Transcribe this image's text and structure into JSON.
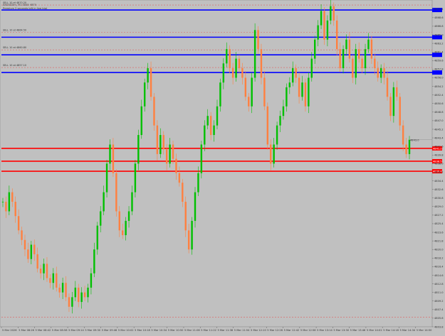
{
  "window": {
    "symbol_line": "XAUUSDm, M1  4845 4870",
    "info_line": "Premium 2 seconds left in live trial"
  },
  "colors": {
    "background": "#c0c0c0",
    "bull_candle": "#00c000",
    "bear_candle": "#ff8040",
    "resistance": "#0000ff",
    "support": "#ff0000",
    "dashed_level": "#e06060",
    "axis_text": "#333333"
  },
  "resistance_levels": [
    {
      "label": "SELL 10 at 4870.20",
      "price": 4870.2
    },
    {
      "label": "SELL 10 at 4864.50",
      "price": 4864.5
    },
    {
      "label": "SELL 10 at 4860.80",
      "price": 4860.8
    },
    {
      "label": "SELL 10 at 4857.10",
      "price": 4857.1
    }
  ],
  "support_levels": [
    {
      "tag": "4841.2",
      "price": 4841.2
    },
    {
      "tag": "4838.5",
      "price": 4838.5
    },
    {
      "tag": "4836.4",
      "price": 4836.4
    }
  ],
  "price_axis": {
    "labels": [
      "4870.4",
      "4868.6",
      "4866.8",
      "4865.0",
      "4863.2",
      "4861.4",
      "4859.6",
      "4857.8",
      "4856.0",
      "4854.2",
      "4852.4",
      "4850.6",
      "4848.8",
      "4847.0",
      "4845.2",
      "4843.4",
      "4841.6",
      "4839.8",
      "4838.0",
      "4836.2",
      "4834.4",
      "4832.6",
      "4830.8",
      "4829.0",
      "4827.2",
      "4825.4",
      "4823.6",
      "4821.8",
      "4820.0",
      "4818.2",
      "4816.4",
      "4814.6",
      "4812.8",
      "4811.0",
      "4809.2",
      "4807.4",
      "4805.6",
      "4803.8"
    ],
    "min": 4803.8,
    "max": 4872.0
  },
  "current_price": {
    "value": 4843.0,
    "tag": "4843.0"
  },
  "time_axis": {
    "labels": [
      "5 Mar 2026",
      "5 Mar 08:26",
      "5 Mar 08:42",
      "5 Mar 08:58",
      "5 Mar 09:14",
      "5 Mar 09:30",
      "5 Mar 09:46",
      "5 Mar 10:02",
      "5 Mar 10:18",
      "5 Mar 10:34",
      "5 Mar 10:50",
      "5 Mar 11:06",
      "5 Mar 11:22",
      "5 Mar 11:38",
      "5 Mar 11:54",
      "5 Mar 12:10",
      "5 Mar 12:26",
      "5 Mar 12:42",
      "5 Mar 12:58",
      "5 Mar 13:14",
      "5 Mar 13:30",
      "5 Mar 13:46",
      "5 Mar 14:02",
      "5 Mar 14:18",
      "5 Mar 14:34",
      "5 Mar 14:50"
    ]
  },
  "chart_data": {
    "type": "line",
    "series": [
      {
        "values": [
          4830,
          4828,
          4832,
          4830,
          4827,
          4824,
          4822,
          4820,
          4818,
          4821,
          4819,
          4816,
          4815,
          4817,
          4814,
          4813,
          4815,
          4812,
          4811,
          4813,
          4810,
          4808,
          4810,
          4812,
          4809,
          4811,
          4810,
          4812,
          4815,
          4820,
          4825,
          4828,
          4832,
          4838,
          4842,
          4836,
          4828,
          4824,
          4823,
          4826,
          4828,
          4832,
          4838,
          4844,
          4850,
          4855,
          4858,
          4852,
          4846,
          4840,
          4844,
          4841,
          4838,
          4842,
          4839,
          4836,
          4834,
          4830,
          4824,
          4820,
          4826,
          4832,
          4836,
          4842,
          4846,
          4848,
          4844,
          4846,
          4850,
          4855,
          4859,
          4862,
          4858,
          4856,
          4860,
          4858,
          4856,
          4852,
          4850,
          4856,
          4866,
          4862,
          4856,
          4850,
          4842,
          4838,
          4842,
          4846,
          4848,
          4850,
          4854,
          4855,
          4858,
          4856,
          4852,
          4855,
          4850,
          4856,
          4860,
          4864,
          4867,
          4870,
          4864,
          4868,
          4871,
          4868,
          4862,
          4858,
          4862,
          4864,
          4860,
          4856,
          4862,
          4860,
          4858,
          4862,
          4864,
          4860,
          4858,
          4856,
          4858,
          4856,
          4852,
          4848,
          4854,
          4852,
          4846,
          4842,
          4840,
          4843
        ]
      }
    ],
    "xlabel": "",
    "ylabel": "",
    "ylim": [
      4803.8,
      4872.0
    ],
    "grid": false
  }
}
